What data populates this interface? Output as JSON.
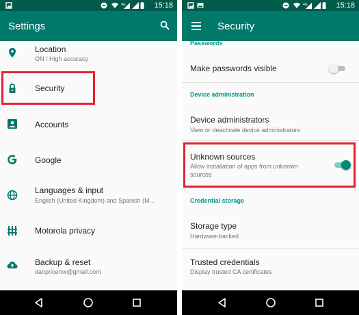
{
  "left": {
    "status_time": "15:18",
    "title": "Settings",
    "items": [
      {
        "icon": "location-pin-icon",
        "title": "Location",
        "subtitle": "ON / High accuracy"
      },
      {
        "icon": "lock-icon",
        "title": "Security"
      },
      {
        "icon": "account-icon",
        "title": "Accounts"
      },
      {
        "icon": "google-icon",
        "title": "Google"
      },
      {
        "icon": "globe-icon",
        "title": "Languages & input",
        "subtitle": "English (United Kingdom) and Spanish (M..."
      },
      {
        "icon": "motorola-icon",
        "title": "Motorola privacy"
      },
      {
        "icon": "cloud-upload-icon",
        "title": "Backup & reset",
        "subtitle": "danpricemx@gmail.com"
      }
    ]
  },
  "right": {
    "status_time": "15:18",
    "title": "Security",
    "sections": {
      "passwords": "Passwords",
      "device_admin": "Device administration",
      "credential_storage": "Credential storage"
    },
    "items": {
      "make_passwords_visible": {
        "title": "Make passwords visible",
        "enabled": false
      },
      "device_administrators": {
        "title": "Device administrators",
        "subtitle": "View or deactivate device administrators"
      },
      "unknown_sources": {
        "title": "Unknown sources",
        "subtitle_line1": "Allow installation of apps from unknown",
        "subtitle_line2": "sources",
        "enabled": true
      },
      "storage_type": {
        "title": "Storage type",
        "subtitle": "Hardware-backed"
      },
      "trusted_credentials": {
        "title": "Trusted credentials",
        "subtitle": "Display trusted CA certificates"
      }
    }
  },
  "colors": {
    "status_bar": "#005b4d",
    "app_bar": "#00796b",
    "accent": "#009688",
    "highlight": "#e5212d",
    "nav_bar": "#000000"
  }
}
